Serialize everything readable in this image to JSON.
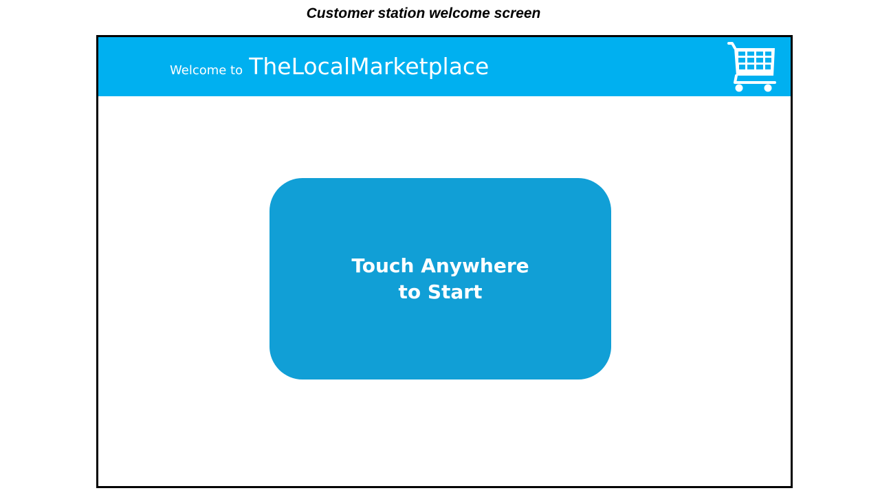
{
  "caption": "Customer station welcome screen",
  "header": {
    "welcome_prefix": "Welcome to",
    "brand_name": "TheLocalMarketplace",
    "icon": "shopping-cart-icon"
  },
  "start_button": {
    "line1": "Touch Anywhere",
    "line2": "to Start"
  },
  "colors": {
    "header_bg": "#00b0f0",
    "button_bg": "#119fd6",
    "text_on_accent": "#ffffff",
    "frame_border": "#000000"
  }
}
